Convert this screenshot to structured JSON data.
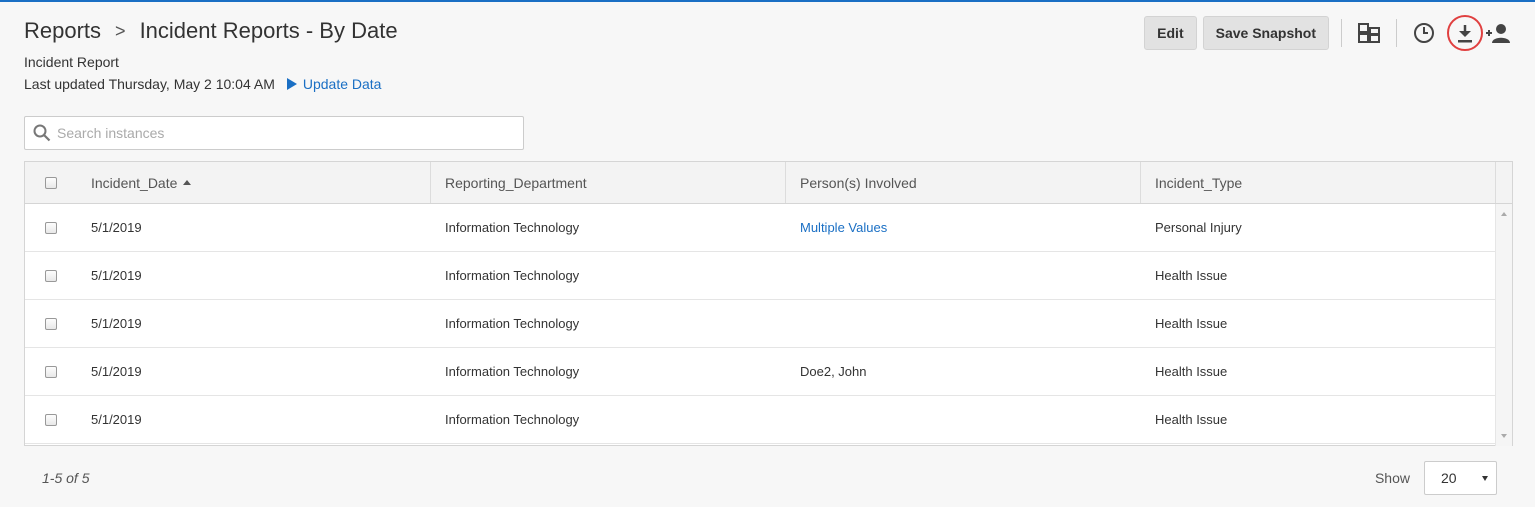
{
  "breadcrumb": {
    "root": "Reports",
    "separator": ">",
    "current": "Incident Reports - By Date"
  },
  "subtitle": "Incident Report",
  "last_updated": "Last updated Thursday, May 2 10:04 AM",
  "update_link": "Update Data",
  "toolbar": {
    "edit_label": "Edit",
    "snapshot_label": "Save Snapshot",
    "icons": [
      "grid-layout-icon",
      "clock-icon",
      "download-icon",
      "add-user-icon"
    ],
    "highlight_color": "#e04040"
  },
  "search": {
    "placeholder": "Search instances"
  },
  "table": {
    "columns": [
      "Incident_Date",
      "Reporting_Department",
      "Person(s) Involved",
      "Incident_Type"
    ],
    "sort": {
      "column": "Incident_Date",
      "direction": "ascending"
    },
    "rows": [
      {
        "date": "5/1/2019",
        "department": "Information Technology",
        "persons": "Multiple Values",
        "persons_is_link": true,
        "type": "Personal Injury"
      },
      {
        "date": "5/1/2019",
        "department": "Information Technology",
        "persons": "",
        "persons_is_link": false,
        "type": "Health Issue"
      },
      {
        "date": "5/1/2019",
        "department": "Information Technology",
        "persons": "",
        "persons_is_link": false,
        "type": "Health Issue"
      },
      {
        "date": "5/1/2019",
        "department": "Information Technology",
        "persons": "Doe2, John",
        "persons_is_link": false,
        "type": "Health Issue"
      },
      {
        "date": "5/1/2019",
        "department": "Information Technology",
        "persons": "",
        "persons_is_link": false,
        "type": "Health Issue"
      }
    ]
  },
  "pager": {
    "info": "1-5 of 5",
    "show_label": "Show",
    "page_size": "20"
  },
  "colors": {
    "accent": "#1a6fc4",
    "background": "#f7f7f7"
  }
}
